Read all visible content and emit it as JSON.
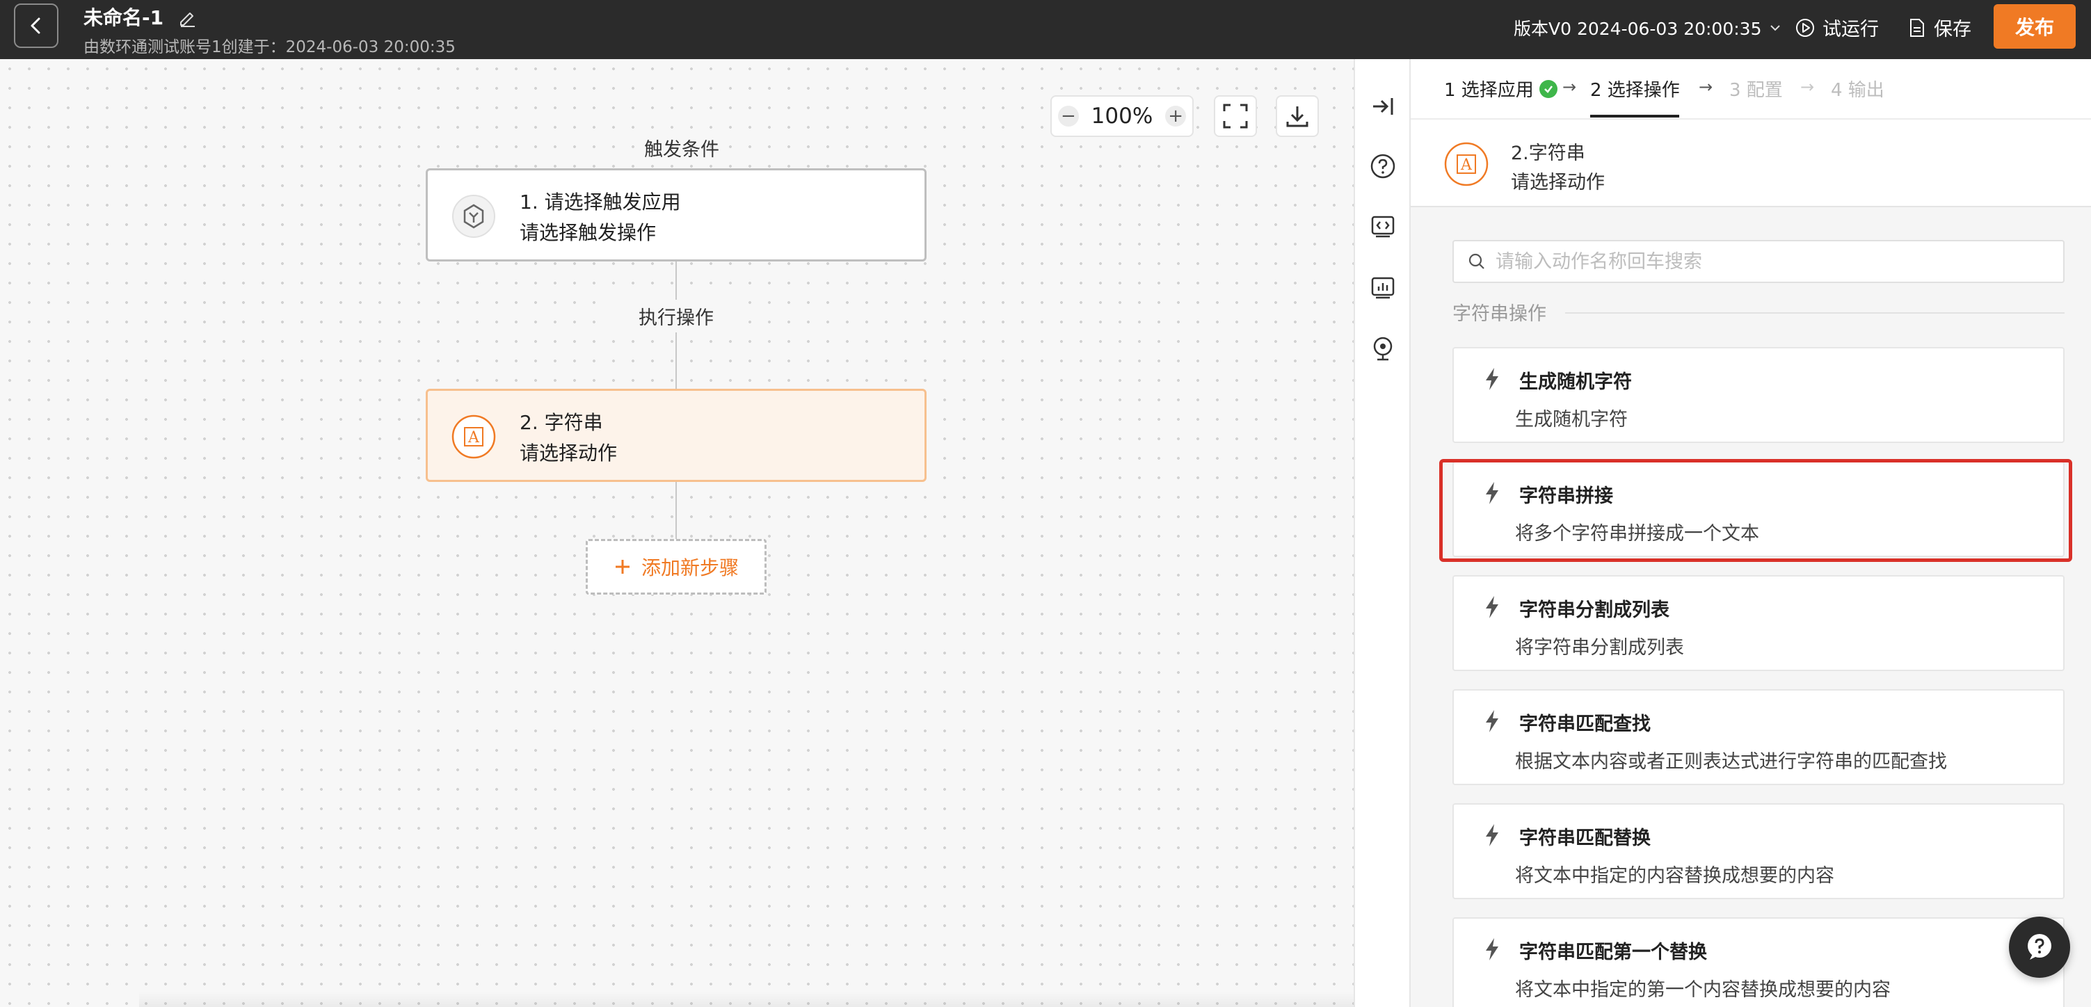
{
  "header": {
    "title": "未命名-1",
    "subtitle": "由数环通测试账号1创建于：2024-06-03 20:00:35",
    "version_label": "版本V0 2024-06-03 20:00:35",
    "test_run_label": "试运行",
    "save_label": "保存",
    "publish_label": "发布",
    "accent_color": "#f07a24"
  },
  "canvas": {
    "zoom_level": "100%",
    "trigger_label": "触发条件",
    "action_label": "执行操作",
    "nodes": [
      {
        "title": "1. 请选择触发应用",
        "subtitle": "请选择触发操作",
        "icon": "hexagon-app-icon"
      },
      {
        "title": "2. 字符串",
        "subtitle": "请选择动作",
        "icon": "string-app-icon"
      }
    ],
    "add_step_label": "添加新步骤"
  },
  "panel": {
    "steps": [
      {
        "label": "1 选择应用",
        "state": "done"
      },
      {
        "label": "2 选择操作",
        "state": "active"
      },
      {
        "label": "3 配置",
        "state": "disabled"
      },
      {
        "label": "4 输出",
        "state": "disabled"
      }
    ],
    "app": {
      "title": "2.字符串",
      "subtitle": "请选择动作"
    },
    "search_placeholder": "请输入动作名称回车搜索",
    "section_label": "字符串操作",
    "actions": [
      {
        "title": "生成随机字符",
        "desc": "生成随机字符"
      },
      {
        "title": "字符串拼接",
        "desc": "将多个字符串拼接成一个文本"
      },
      {
        "title": "字符串分割成列表",
        "desc": "将字符串分割成列表"
      },
      {
        "title": "字符串匹配查找",
        "desc": "根据文本内容或者正则表达式进行字符串的匹配查找"
      },
      {
        "title": "字符串匹配替换",
        "desc": "将文本中指定的内容替换成想要的内容"
      },
      {
        "title": "字符串匹配第一个替换",
        "desc": "将文本中指定的第一个内容替换成想要的内容"
      }
    ]
  }
}
